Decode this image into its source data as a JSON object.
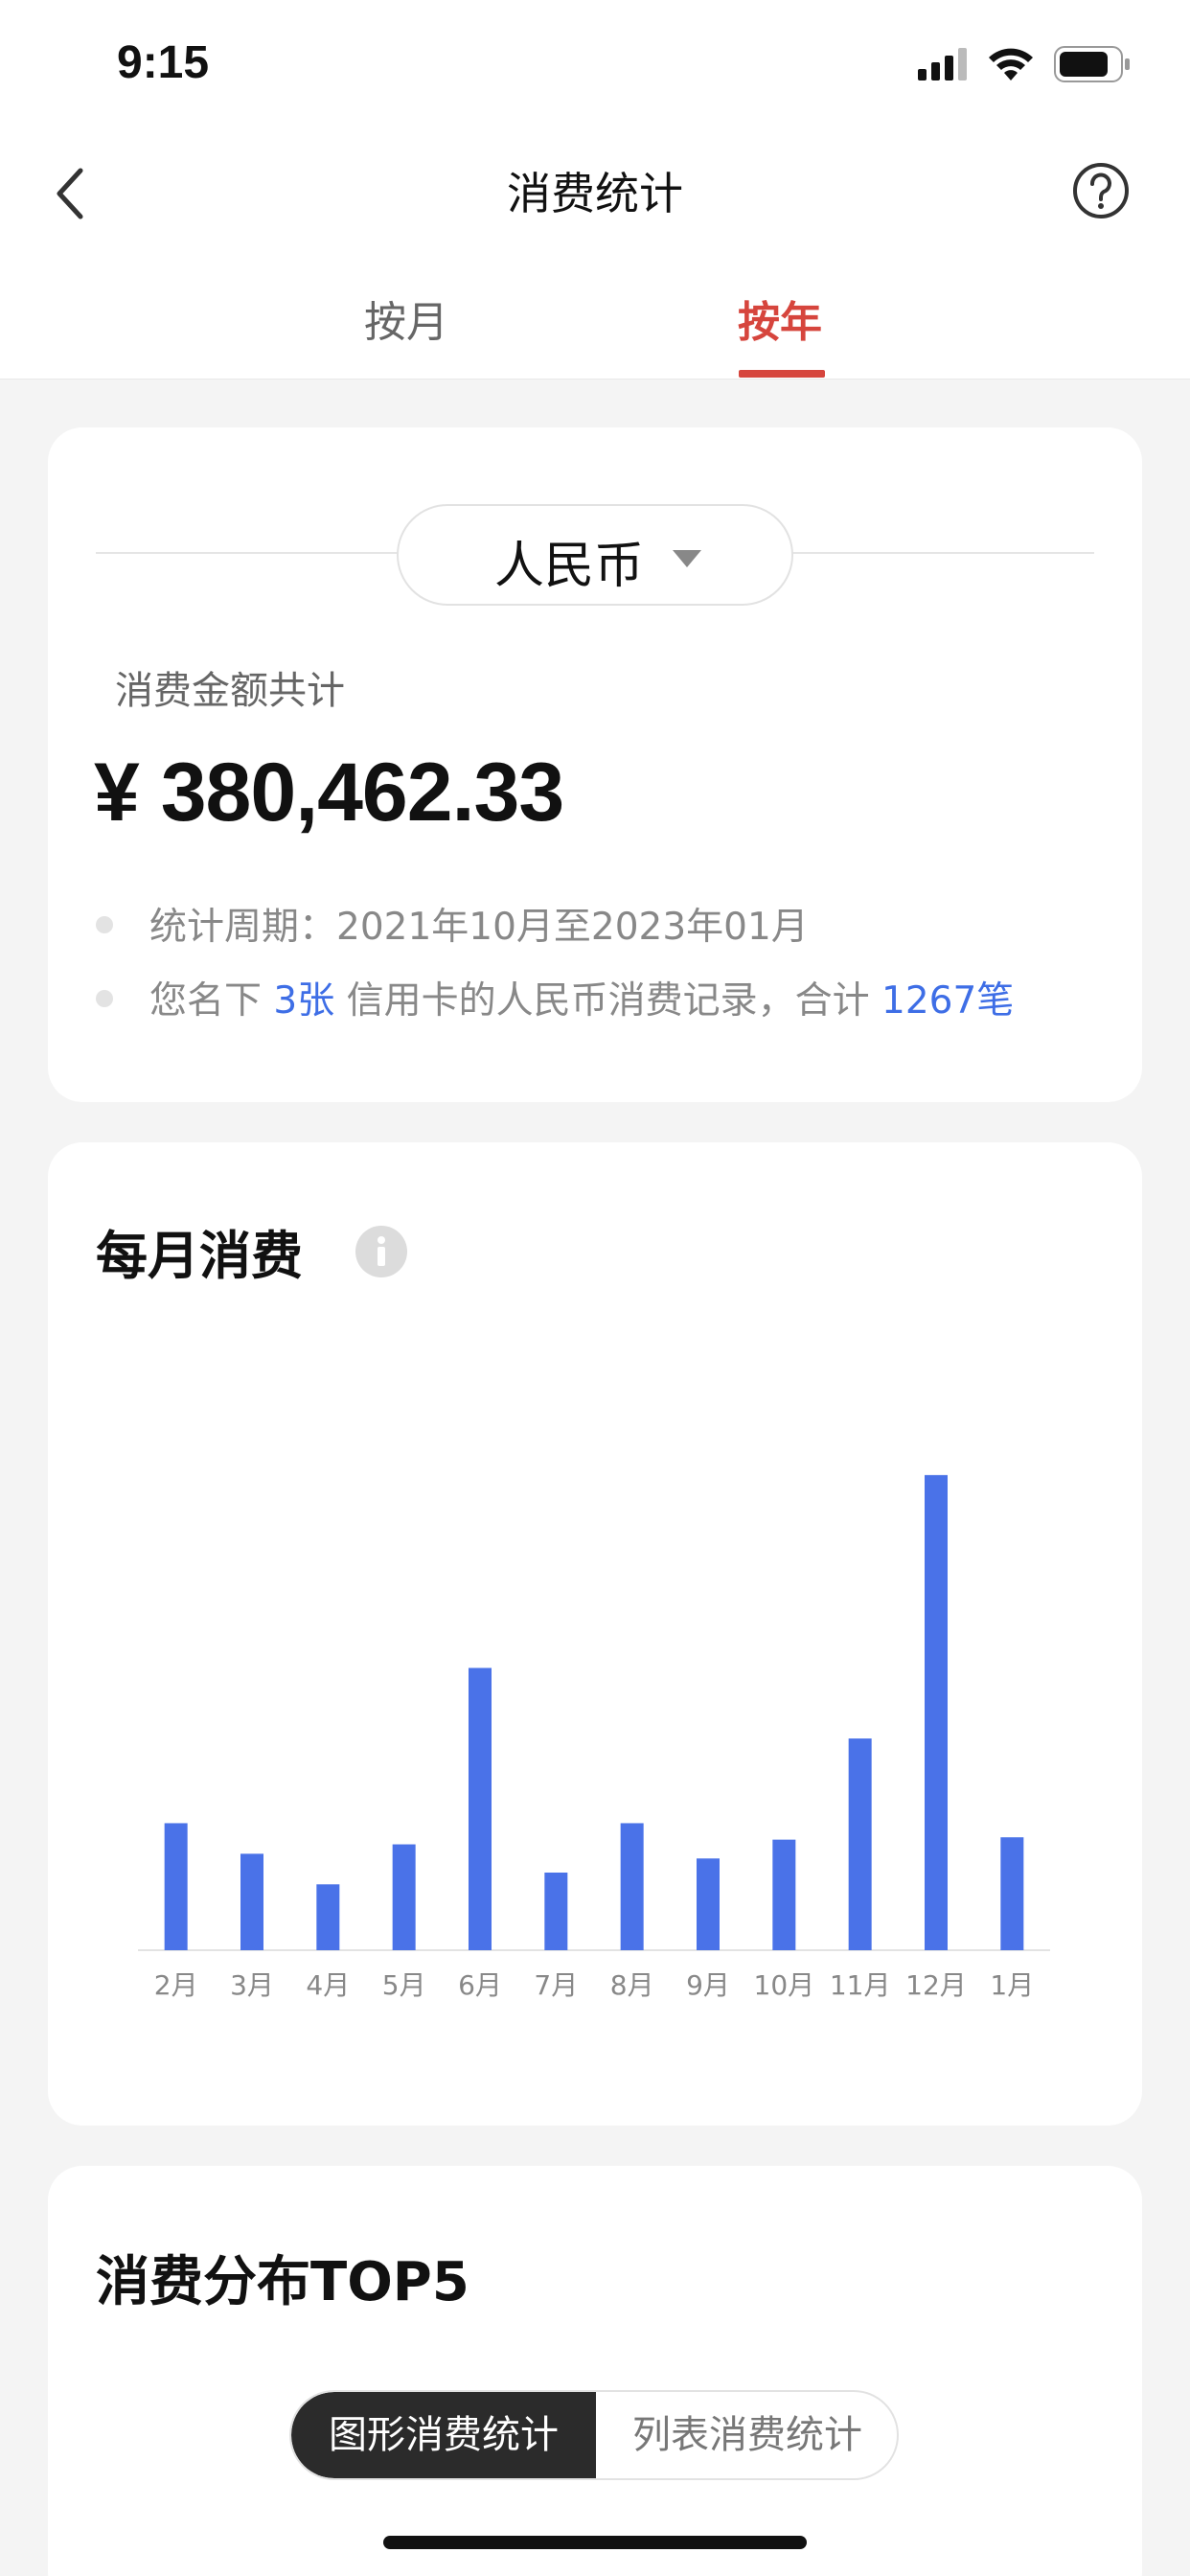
{
  "status_bar": {
    "time": "9:15"
  },
  "nav": {
    "title": "消费统计"
  },
  "tabs": [
    {
      "label": "按月",
      "active": false
    },
    {
      "label": "按年",
      "active": true
    }
  ],
  "summary": {
    "currency": "人民币",
    "total_label": "消费金额共计",
    "total_amount": "¥ 380,462.33",
    "period_label": "统计周期：",
    "period_value": "2021年10月至2023年01月",
    "records_prefix": "您名下 ",
    "records_cards": "3张",
    "records_middle": " 信用卡的人民币消费记录，合计 ",
    "records_count": "1267笔"
  },
  "monthly": {
    "title": "每月消费"
  },
  "chart_data": {
    "type": "bar",
    "title": "每月消费",
    "categories": [
      "2月",
      "3月",
      "4月",
      "5月",
      "6月",
      "7月",
      "8月",
      "9月",
      "10月",
      "11月",
      "12月",
      "1月"
    ],
    "values": [
      27,
      20.5,
      14,
      22.5,
      60,
      16.5,
      27,
      19.5,
      23.5,
      45,
      101,
      24
    ],
    "ylim": [
      0,
      110
    ],
    "grid": false,
    "color": "#4a72e8"
  },
  "top5": {
    "title": "消费分布TOP5",
    "segments": [
      {
        "label": "图形消费统计",
        "active": true
      },
      {
        "label": "列表消费统计",
        "active": false
      }
    ]
  },
  "colors": {
    "accent_red": "#d6453d",
    "link_blue": "#3e6ee6",
    "bar_blue": "#4a72e8"
  }
}
